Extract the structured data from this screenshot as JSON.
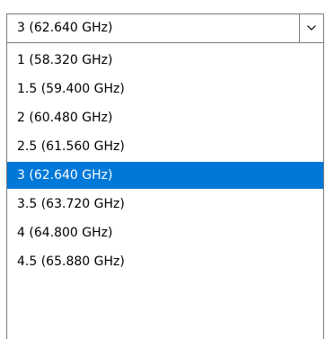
{
  "dropdown": {
    "selected_value": "3 (62.640 GHz)",
    "arrow_icon": "chevron-down-icon",
    "selected_index": 4,
    "colors": {
      "highlight": "#0078d7",
      "highlight_text": "#ffffff",
      "border": "#7a7a7a"
    },
    "options": [
      {
        "label": "1 (58.320 GHz)"
      },
      {
        "label": "1.5 (59.400 GHz)"
      },
      {
        "label": "2 (60.480 GHz)"
      },
      {
        "label": "2.5 (61.560 GHz)"
      },
      {
        "label": "3 (62.640 GHz)"
      },
      {
        "label": "3.5 (63.720 GHz)"
      },
      {
        "label": "4 (64.800 GHz)"
      },
      {
        "label": "4.5 (65.880 GHz)"
      }
    ]
  }
}
